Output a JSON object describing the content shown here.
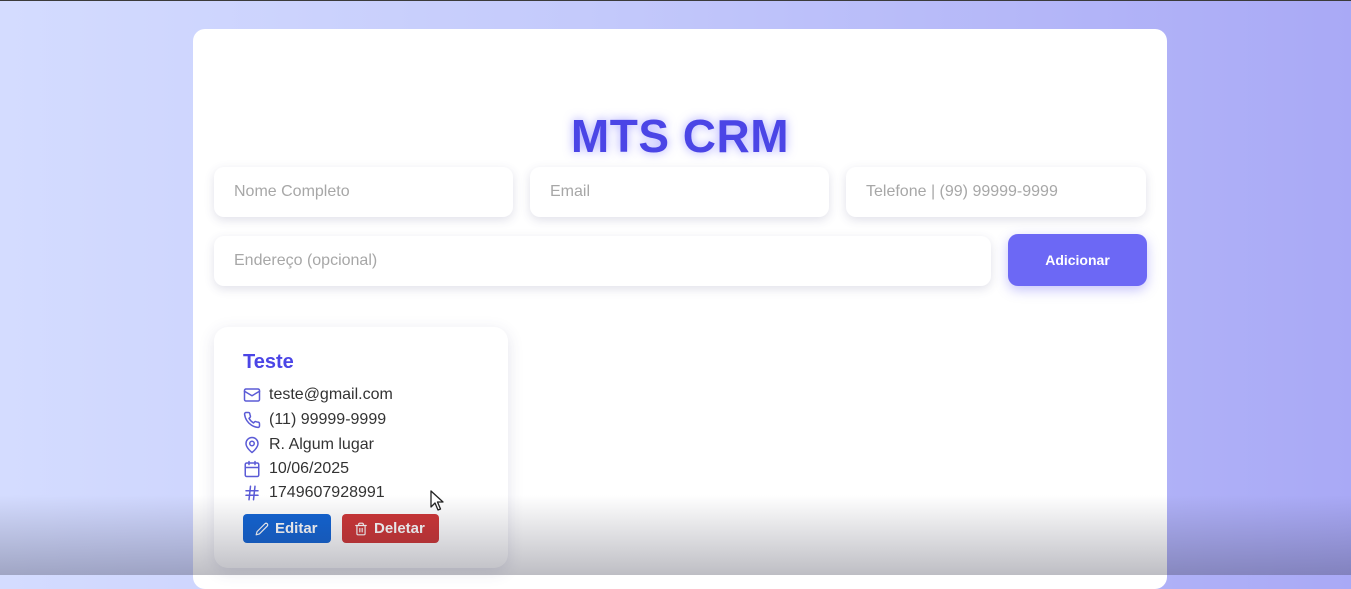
{
  "app": {
    "title": "MTS CRM"
  },
  "form": {
    "name_placeholder": "Nome Completo",
    "email_placeholder": "Email",
    "phone_placeholder": "Telefone | (99) 99999-9999",
    "address_placeholder": "Endereço (opcional)",
    "add_label": "Adicionar"
  },
  "contacts": [
    {
      "name": "Teste",
      "email": "teste@gmail.com",
      "phone": "(11) 99999-9999",
      "address": "R. Algum lugar",
      "date": "10/06/2025",
      "id": "1749607928991",
      "edit_label": "Editar",
      "delete_label": "Deletar"
    }
  ],
  "icons": {
    "email": "mail-icon",
    "phone": "phone-icon",
    "address": "map-pin-icon",
    "date": "calendar-icon",
    "id": "hash-icon",
    "edit": "pencil-icon",
    "delete": "trash-icon"
  },
  "colors": {
    "accent": "#4b45e6",
    "add_button": "#6c68f5",
    "edit_button": "#1264d4",
    "delete_button": "#cf3535",
    "icon": "#5b5bd6"
  }
}
